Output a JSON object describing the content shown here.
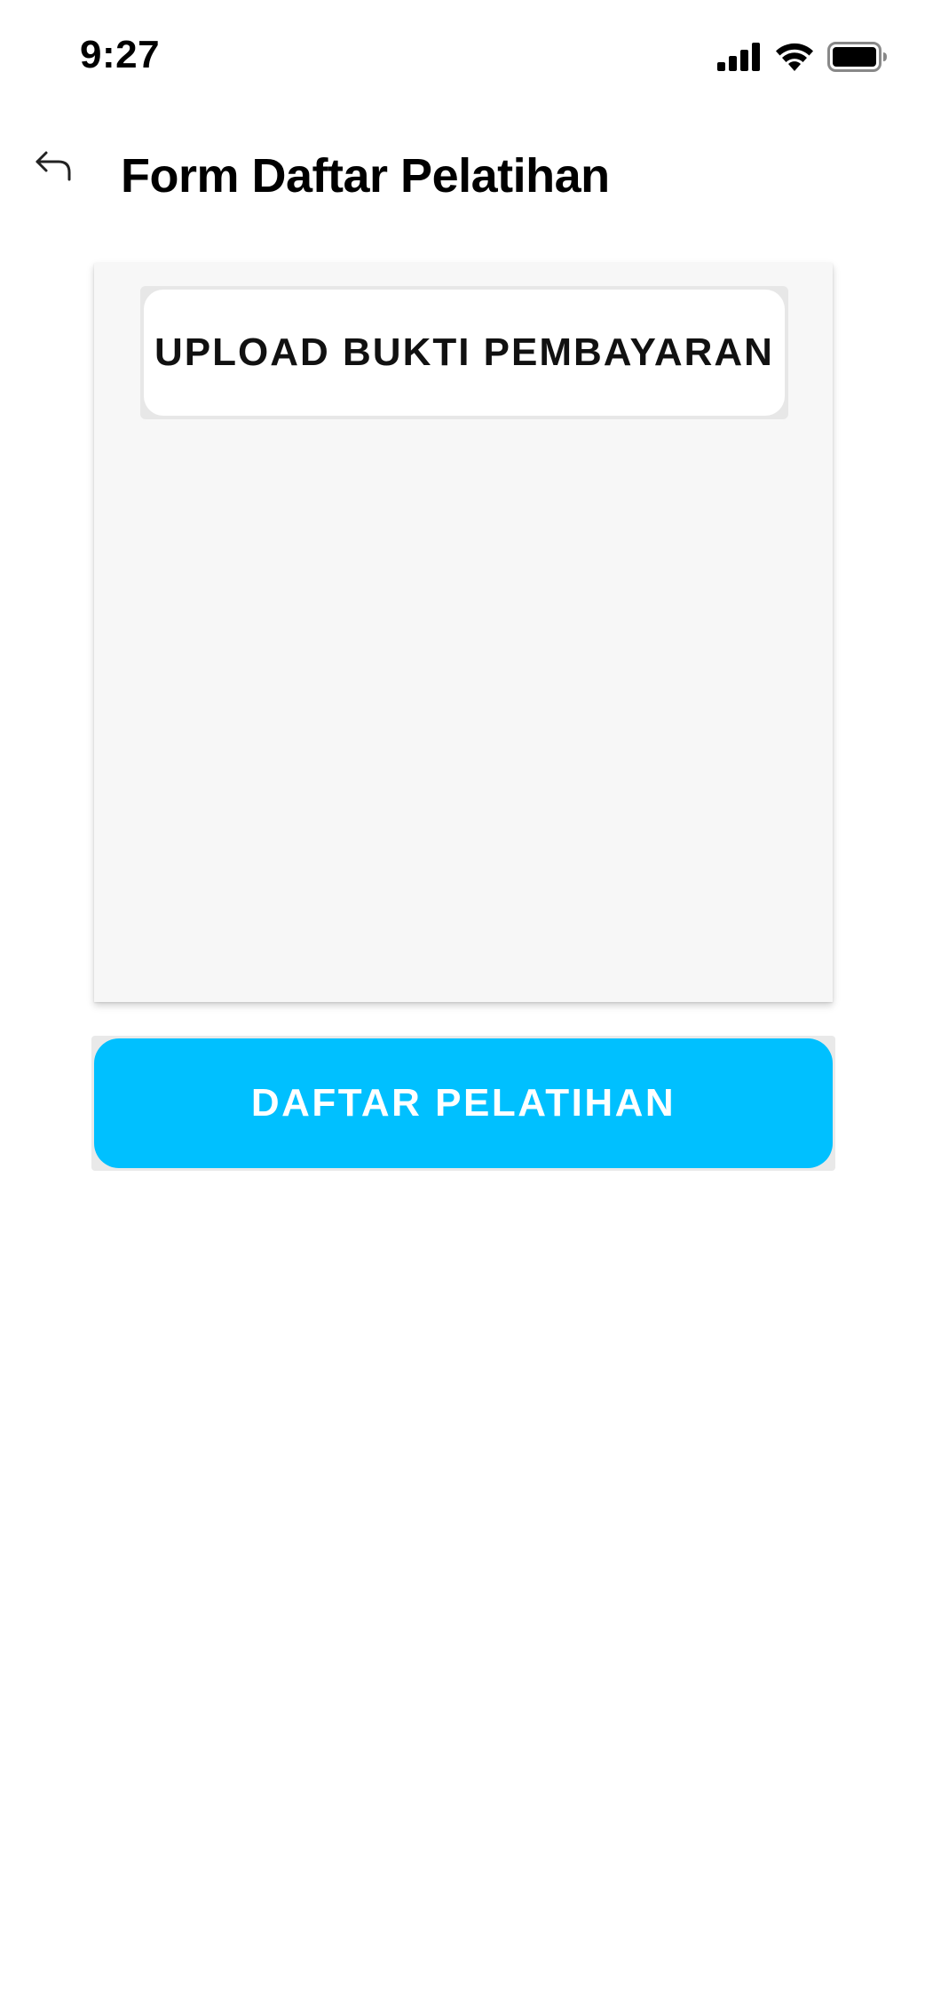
{
  "status_bar": {
    "time": "9:27",
    "icons": [
      "cellular-signal-icon",
      "wifi-icon",
      "battery-icon"
    ]
  },
  "header": {
    "back_icon": "back-arrow-icon",
    "title": "Form Daftar Pelatihan"
  },
  "upload": {
    "button_label": "UPLOAD BUKTI PEMBAYARAN"
  },
  "actions": {
    "submit_label": "DAFTAR PELATIHAN"
  },
  "colors": {
    "primary": "#00c0ff",
    "card_background": "#f7f7f7",
    "page_background": "#ffffff"
  }
}
